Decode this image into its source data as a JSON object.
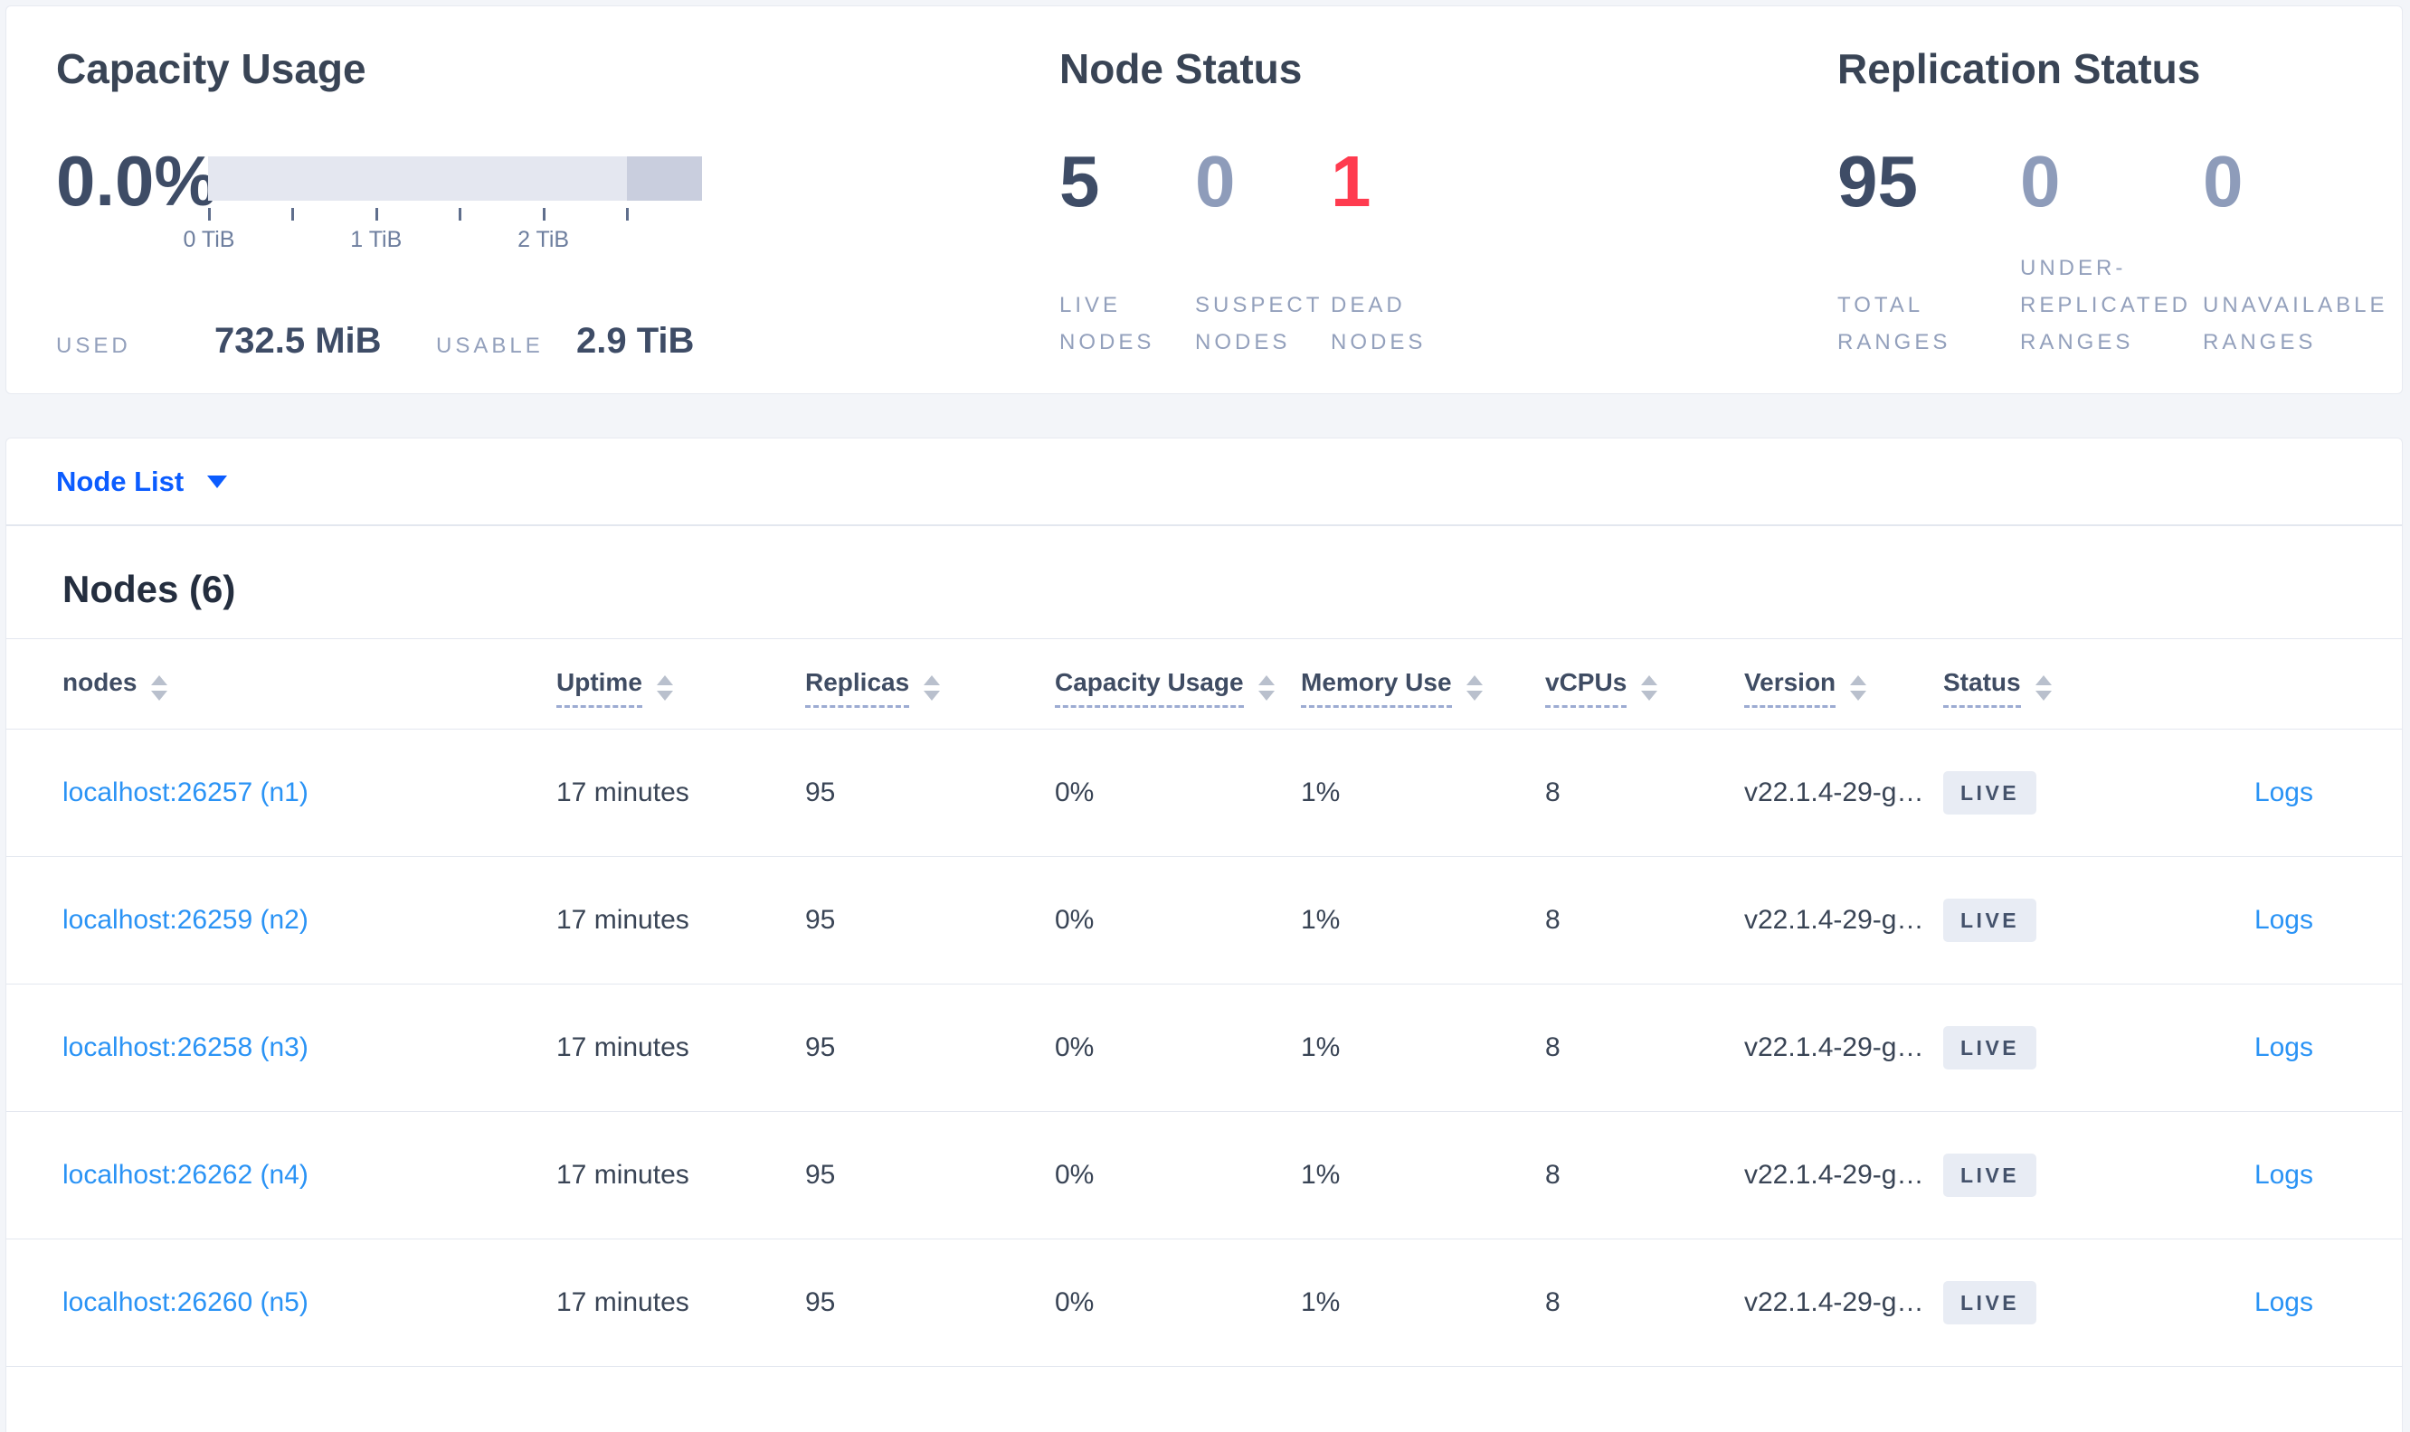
{
  "summary": {
    "capacity": {
      "title": "Capacity Usage",
      "percent": "0.0%",
      "tick_labels": [
        "0 TiB",
        null,
        "1 TiB",
        null,
        "2 TiB",
        null
      ],
      "used_label": "USED",
      "used_value": "732.5 MiB",
      "usable_label": "USABLE",
      "usable_value": "2.9 TiB"
    },
    "node_status": {
      "title": "Node Status",
      "stats": [
        {
          "value": "5",
          "tone": "dark",
          "label_lines": [
            "LIVE",
            "NODES"
          ]
        },
        {
          "value": "0",
          "tone": "muted",
          "label_lines": [
            "SUSPECT",
            "NODES"
          ]
        },
        {
          "value": "1",
          "tone": "red",
          "label_lines": [
            "DEAD",
            "NODES"
          ]
        }
      ]
    },
    "replication_status": {
      "title": "Replication Status",
      "stats": [
        {
          "value": "95",
          "tone": "dark",
          "label_lines": [
            "TOTAL",
            "RANGES"
          ]
        },
        {
          "value": "0",
          "tone": "muted",
          "label_lines": [
            "UNDER-",
            "REPLICATED",
            "RANGES"
          ]
        },
        {
          "value": "0",
          "tone": "muted",
          "label_lines": [
            "UNAVAILABLE",
            "RANGES"
          ]
        }
      ]
    }
  },
  "node_list": {
    "dropdown_label": "Node List",
    "section_title": "Nodes (6)",
    "columns": [
      {
        "label": "nodes",
        "dashed": false
      },
      {
        "label": "Uptime",
        "dashed": true
      },
      {
        "label": "Replicas",
        "dashed": true
      },
      {
        "label": "Capacity Usage",
        "dashed": true
      },
      {
        "label": "Memory Use",
        "dashed": true
      },
      {
        "label": "vCPUs",
        "dashed": true
      },
      {
        "label": "Version",
        "dashed": true
      },
      {
        "label": "Status",
        "dashed": true
      }
    ],
    "rows": [
      {
        "address": "localhost:26257 (n1)",
        "uptime": "17 minutes",
        "replicas": "95",
        "capacity_usage": "0%",
        "memory_use": "1%",
        "vcpus": "8",
        "version": "v22.1.4-29-g…",
        "status": "LIVE",
        "logs": "Logs"
      },
      {
        "address": "localhost:26259 (n2)",
        "uptime": "17 minutes",
        "replicas": "95",
        "capacity_usage": "0%",
        "memory_use": "1%",
        "vcpus": "8",
        "version": "v22.1.4-29-g…",
        "status": "LIVE",
        "logs": "Logs"
      },
      {
        "address": "localhost:26258 (n3)",
        "uptime": "17 minutes",
        "replicas": "95",
        "capacity_usage": "0%",
        "memory_use": "1%",
        "vcpus": "8",
        "version": "v22.1.4-29-g…",
        "status": "LIVE",
        "logs": "Logs"
      },
      {
        "address": "localhost:26262 (n4)",
        "uptime": "17 minutes",
        "replicas": "95",
        "capacity_usage": "0%",
        "memory_use": "1%",
        "vcpus": "8",
        "version": "v22.1.4-29-g…",
        "status": "LIVE",
        "logs": "Logs"
      },
      {
        "address": "localhost:26260 (n5)",
        "uptime": "17 minutes",
        "replicas": "95",
        "capacity_usage": "0%",
        "memory_use": "1%",
        "vcpus": "8",
        "version": "v22.1.4-29-g…",
        "status": "LIVE",
        "logs": "Logs"
      }
    ]
  },
  "colors": {
    "accent_blue": "#0b5cff",
    "link_blue": "#2a93f5",
    "dead_red": "#ff3b4f",
    "dark_value": "#3e4c66",
    "muted_value": "#8e9cba",
    "badge_bg": "#e8ecf4",
    "bar_track": "#e4e7f0",
    "bar_segment": "#c9cede"
  }
}
